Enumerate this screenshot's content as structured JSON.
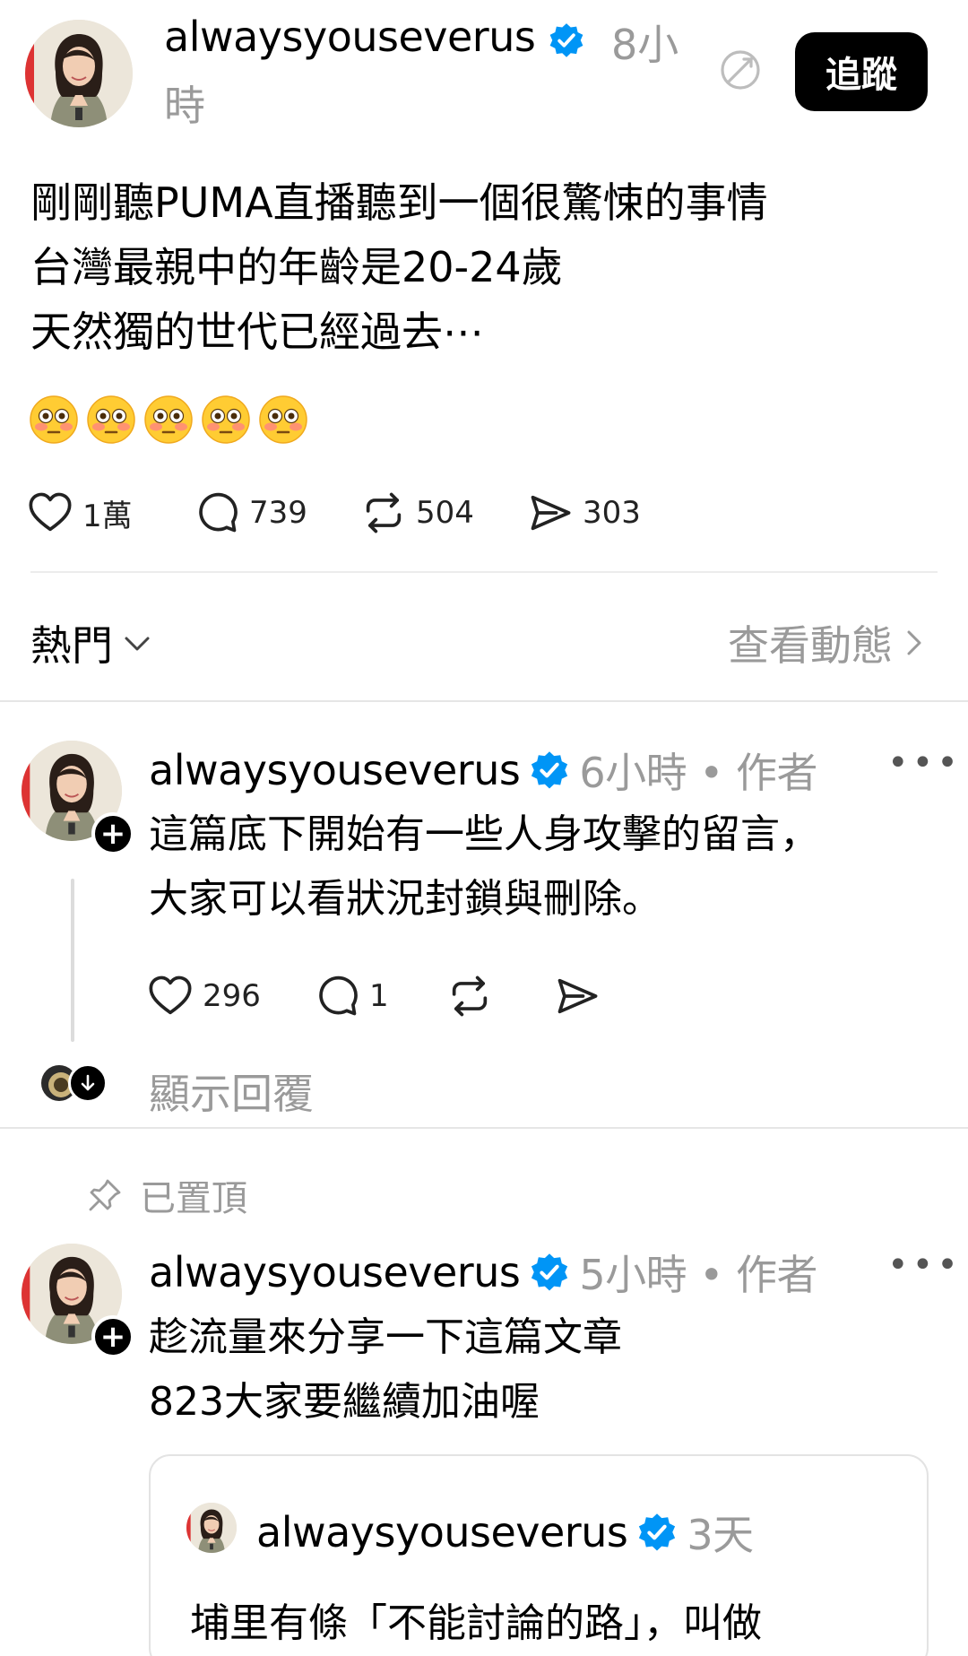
{
  "post": {
    "username": "alwaysyouseverus",
    "time_part1": "8小",
    "time_part2": "時",
    "follow_label": "追蹤",
    "body": "剛剛聽PUMA直播聽到一個很驚悚的事情\n台灣最親中的年齡是20-24歲\n天然獨的世代已經過去⋯",
    "emoji_count": 5,
    "likes": "1萬",
    "comments": "739",
    "reposts": "504",
    "shares": "303"
  },
  "sort": {
    "label": "熱門",
    "activity_label": "查看動態"
  },
  "replies": [
    {
      "username": "alwaysyouseverus",
      "meta": "6小時 • 作者",
      "body": "這篇底下開始有一些人身攻擊的留言，\n大家可以看狀況封鎖與刪除。",
      "likes": "296",
      "comments": "1",
      "show_replies": "顯示回覆"
    },
    {
      "pinned_label": "已置頂",
      "username": "alwaysyouseverus",
      "meta": "5小時 • 作者",
      "body": "趁流量來分享一下這篇文章\n823大家要繼續加油喔",
      "quote": {
        "username": "alwaysyouseverus",
        "time": "3天",
        "body": "埔里有條「不能討論的路」，叫做"
      }
    }
  ],
  "colors": {
    "verified_blue": "#0095f6",
    "muted_text": "#9a9a9a",
    "follow_bg": "#000000"
  }
}
